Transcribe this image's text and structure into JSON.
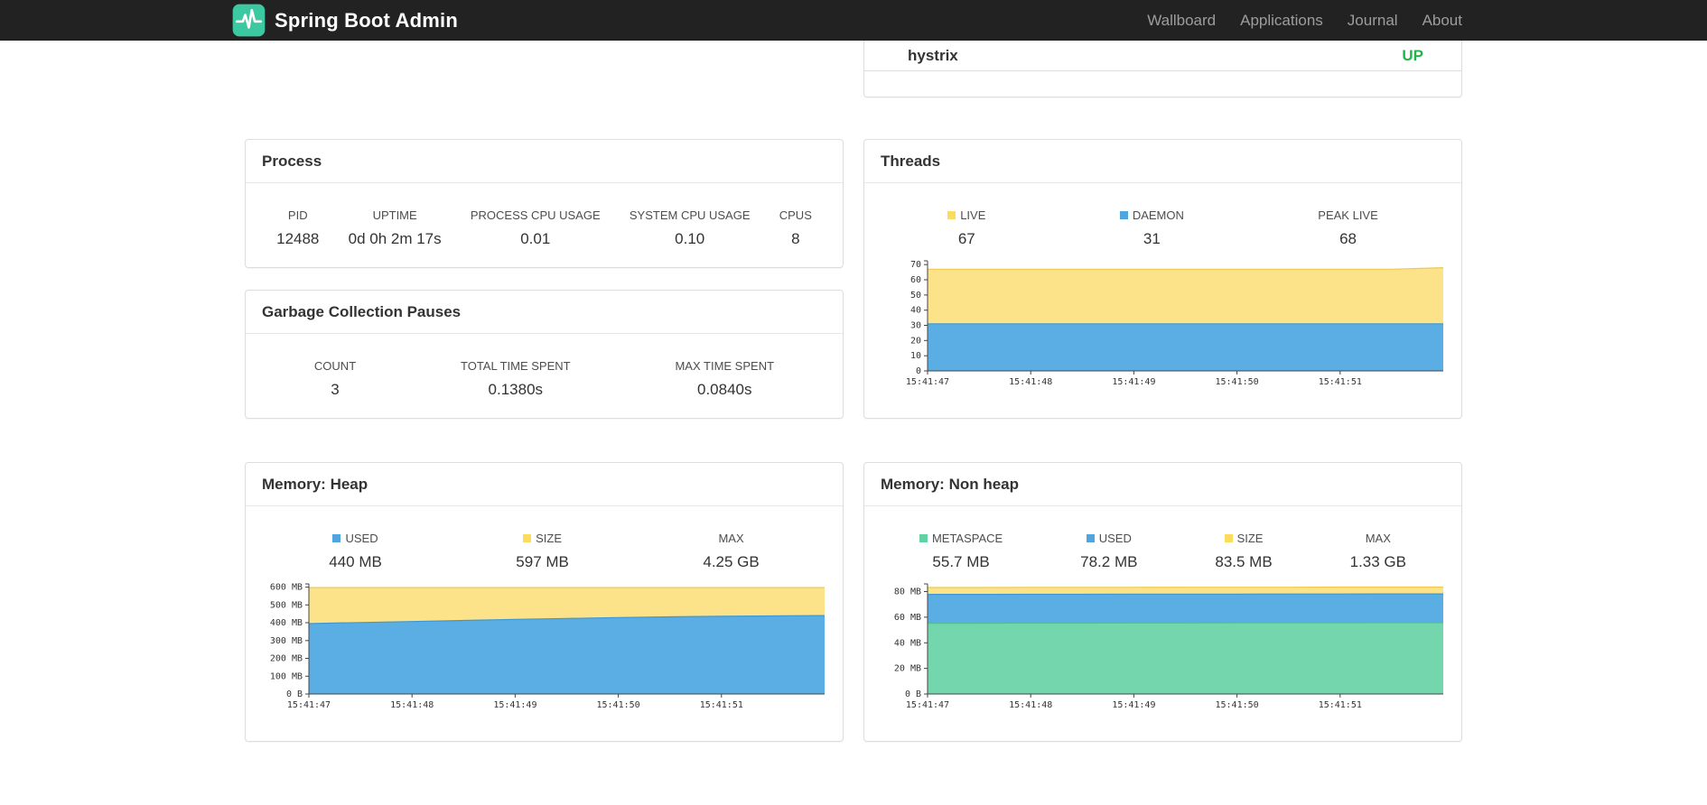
{
  "colors": {
    "navbar_bg": "#222222",
    "brand_green": "#3CC8A0",
    "status_up": "#24B34B",
    "panel_border": "#dddddd"
  },
  "navbar": {
    "brand": "Spring Boot Admin",
    "items": [
      {
        "label": "Wallboard"
      },
      {
        "label": "Applications"
      },
      {
        "label": "Journal"
      },
      {
        "label": "About"
      }
    ]
  },
  "applications": [
    {
      "name": "hystrix",
      "status": "UP"
    }
  ],
  "process": {
    "title": "Process",
    "stats": [
      {
        "label": "PID",
        "value": "12488"
      },
      {
        "label": "UPTIME",
        "value": "0d 0h 2m 17s"
      },
      {
        "label": "PROCESS CPU USAGE",
        "value": "0.01"
      },
      {
        "label": "SYSTEM CPU USAGE",
        "value": "0.10"
      },
      {
        "label": "CPUS",
        "value": "8"
      }
    ]
  },
  "gc": {
    "title": "Garbage Collection Pauses",
    "stats": [
      {
        "label": "COUNT",
        "value": "3"
      },
      {
        "label": "TOTAL TIME SPENT",
        "value": "0.1380s"
      },
      {
        "label": "MAX TIME SPENT",
        "value": "0.0840s"
      }
    ]
  },
  "threads": {
    "title": "Threads",
    "stats": [
      {
        "label": "LIVE",
        "value": "67",
        "swatch": "#FBDC5C"
      },
      {
        "label": "DAEMON",
        "value": "31",
        "swatch": "#4FA6DF"
      },
      {
        "label": "PEAK LIVE",
        "value": "68"
      }
    ]
  },
  "heap": {
    "title": "Memory: Heap",
    "stats": [
      {
        "label": "USED",
        "value": "440 MB",
        "swatch": "#4FA6DF"
      },
      {
        "label": "SIZE",
        "value": "597 MB",
        "swatch": "#FBDC5C"
      },
      {
        "label": "MAX",
        "value": "4.25 GB"
      }
    ]
  },
  "nonheap": {
    "title": "Memory: Non heap",
    "stats": [
      {
        "label": "METASPACE",
        "value": "55.7 MB",
        "swatch": "#63D1A4"
      },
      {
        "label": "USED",
        "value": "78.2 MB",
        "swatch": "#4FA6DF"
      },
      {
        "label": "SIZE",
        "value": "83.5 MB",
        "swatch": "#FBDC5C"
      },
      {
        "label": "MAX",
        "value": "1.33 GB"
      }
    ]
  },
  "chart_data": [
    {
      "id": "threads",
      "type": "area",
      "stacked": true,
      "title": "Threads",
      "x_labels": [
        "15:41:47",
        "15:41:48",
        "15:41:49",
        "15:41:50",
        "15:41:51"
      ],
      "x_intervals": 5,
      "ymax": 72.5,
      "ylim": [
        0,
        70
      ],
      "yticks": [
        {
          "v": 0,
          "label": "0"
        },
        {
          "v": 10,
          "label": "10"
        },
        {
          "v": 20,
          "label": "20"
        },
        {
          "v": 30,
          "label": "30"
        },
        {
          "v": 40,
          "label": "40"
        },
        {
          "v": 50,
          "label": "50"
        },
        {
          "v": 60,
          "label": "60"
        },
        {
          "v": 70,
          "label": "70"
        }
      ],
      "series": [
        {
          "name": "LIVE (stack top)",
          "color": "#FCE38A",
          "stroke": "#EFC94F",
          "values": [
            67,
            67,
            67,
            67,
            67,
            67,
            67,
            67,
            67,
            67,
            68
          ]
        },
        {
          "name": "DAEMON",
          "color": "#5AAEE3",
          "stroke": "#3E97D4",
          "values": [
            31,
            31,
            31,
            31,
            31,
            31,
            31,
            31,
            31,
            31,
            31
          ]
        }
      ]
    },
    {
      "id": "memory-heap",
      "type": "area",
      "stacked": true,
      "title": "Memory: Heap (MB)",
      "x_labels": [
        "15:41:47",
        "15:41:48",
        "15:41:49",
        "15:41:50",
        "15:41:51"
      ],
      "x_intervals": 5,
      "ymax": 618,
      "ylim": [
        0,
        600
      ],
      "yticks": [
        {
          "v": 0,
          "label": "0 B"
        },
        {
          "v": 100,
          "label": "100 MB"
        },
        {
          "v": 200,
          "label": "200 MB"
        },
        {
          "v": 300,
          "label": "300 MB"
        },
        {
          "v": 400,
          "label": "400 MB"
        },
        {
          "v": 500,
          "label": "500 MB"
        },
        {
          "v": 600,
          "label": "600 MB"
        }
      ],
      "series": [
        {
          "name": "SIZE (stack top)",
          "color": "#FCE38A",
          "stroke": "#EFC94F",
          "values": [
            597,
            597,
            597,
            597,
            597,
            597,
            597,
            597,
            597,
            597,
            597
          ]
        },
        {
          "name": "USED",
          "color": "#5AAEE3",
          "stroke": "#3E97D4",
          "values": [
            395,
            401,
            407,
            413,
            419,
            424,
            429,
            433,
            436,
            438,
            440
          ]
        }
      ]
    },
    {
      "id": "memory-nonheap",
      "type": "area",
      "stacked": true,
      "title": "Memory: Non heap (MB)",
      "x_labels": [
        "15:41:47",
        "15:41:48",
        "15:41:49",
        "15:41:50",
        "15:41:51"
      ],
      "x_intervals": 5,
      "ymax": 86,
      "ylim": [
        0,
        80
      ],
      "yticks": [
        {
          "v": 0,
          "label": "0 B"
        },
        {
          "v": 20,
          "label": "20 MB"
        },
        {
          "v": 40,
          "label": "40 MB"
        },
        {
          "v": 60,
          "label": "60 MB"
        },
        {
          "v": 80,
          "label": "80 MB"
        }
      ],
      "series": [
        {
          "name": "SIZE (stack top)",
          "color": "#FCE38A",
          "stroke": "#EFC94F",
          "values": [
            83.2,
            83.2,
            83.3,
            83.3,
            83.3,
            83.4,
            83.4,
            83.4,
            83.5,
            83.5,
            83.5
          ]
        },
        {
          "name": "USED",
          "color": "#5AAEE3",
          "stroke": "#3E97D4",
          "values": [
            77.8,
            77.8,
            77.9,
            77.9,
            78.0,
            78.0,
            78.0,
            78.1,
            78.1,
            78.2,
            78.2
          ]
        },
        {
          "name": "METASPACE",
          "color": "#74D6AC",
          "stroke": "#4FC092",
          "values": [
            55.3,
            55.3,
            55.4,
            55.4,
            55.5,
            55.5,
            55.6,
            55.6,
            55.6,
            55.7,
            55.7
          ]
        }
      ]
    }
  ]
}
